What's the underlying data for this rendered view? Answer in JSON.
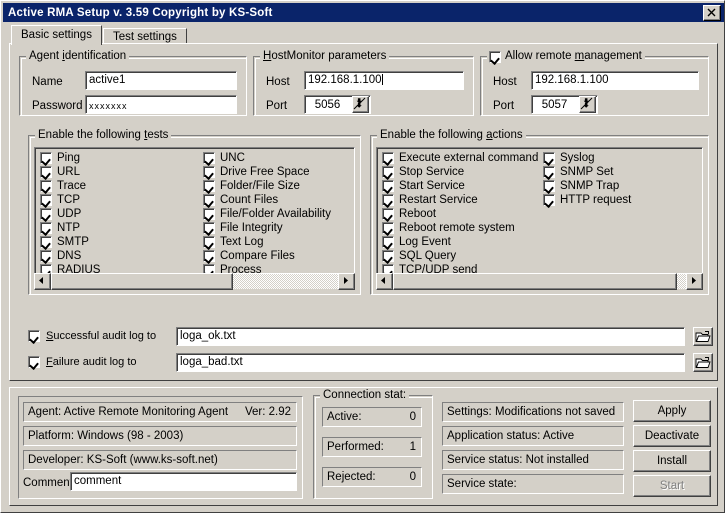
{
  "window": {
    "title": "Active RMA Setup   v. 3.59   Copyright by KS-Soft",
    "close_label": "close-icon"
  },
  "tabs": [
    {
      "label": "Basic settings",
      "active": true
    },
    {
      "label": "Test settings",
      "active": false
    }
  ],
  "agent_identification": {
    "legend": "Agent identification",
    "name_label": "Name",
    "name_value": "active1",
    "password_label": "Password",
    "password_value": "xxxxxxx"
  },
  "hostmonitor_parameters": {
    "legend": "HostMonitor parameters",
    "host_label": "Host",
    "host_value": "192.168.1.100",
    "port_label": "Port",
    "port_value": "5056"
  },
  "remote_management": {
    "legend": "Allow remote management",
    "checked": true,
    "host_label": "Host",
    "host_value": "192.168.1.100",
    "port_label": "Port",
    "port_value": "5057"
  },
  "tests": {
    "legend": "Enable the following tests",
    "column1": [
      {
        "label": "Ping",
        "checked": true
      },
      {
        "label": "URL",
        "checked": true
      },
      {
        "label": "Trace",
        "checked": true
      },
      {
        "label": "TCP",
        "checked": true
      },
      {
        "label": "UDP",
        "checked": true
      },
      {
        "label": "NTP",
        "checked": true
      },
      {
        "label": "SMTP",
        "checked": true
      },
      {
        "label": "DNS",
        "checked": true
      },
      {
        "label": "RADIUS",
        "checked": true
      }
    ],
    "column2": [
      {
        "label": "UNC",
        "checked": true
      },
      {
        "label": "Drive Free Space",
        "checked": true
      },
      {
        "label": "Folder/File Size",
        "checked": true
      },
      {
        "label": "Count Files",
        "checked": true
      },
      {
        "label": "File/Folder Availability",
        "checked": true
      },
      {
        "label": "File Integrity",
        "checked": true
      },
      {
        "label": "Text Log",
        "checked": true
      },
      {
        "label": "Compare Files",
        "checked": true
      },
      {
        "label": "Process",
        "checked": true
      }
    ]
  },
  "actions": {
    "legend": "Enable the following actions",
    "column1": [
      {
        "label": "Execute external command",
        "checked": true
      },
      {
        "label": "Stop Service",
        "checked": true
      },
      {
        "label": "Start Service",
        "checked": true
      },
      {
        "label": "Restart Service",
        "checked": true
      },
      {
        "label": "Reboot",
        "checked": true
      },
      {
        "label": "Reboot remote system",
        "checked": true
      },
      {
        "label": "Log Event",
        "checked": true
      },
      {
        "label": "SQL Query",
        "checked": true
      },
      {
        "label": "TCP/UDP send",
        "checked": true
      }
    ],
    "column2": [
      {
        "label": "Syslog",
        "checked": true
      },
      {
        "label": "SNMP Set",
        "checked": true
      },
      {
        "label": "SNMP Trap",
        "checked": true
      },
      {
        "label": "HTTP request",
        "checked": true
      }
    ]
  },
  "audit_logs": [
    {
      "label": "Successful audit log to",
      "accel": "S",
      "checked": true,
      "value": "loga_ok.txt",
      "browse": "folder-open-icon"
    },
    {
      "label": "Failure audit log to",
      "accel": "F",
      "checked": true,
      "value": "loga_bad.txt",
      "browse": "folder-open-icon"
    }
  ],
  "agent_info": {
    "agent": "Agent: Active Remote Monitoring Agent",
    "version": "Ver: 2.92",
    "platform": "Platform: Windows (98 - 2003)",
    "developer": "Developer: KS-Soft (www.ks-soft.net)",
    "comment_label": "Comment",
    "comment_value": "comment"
  },
  "connection_stat": {
    "legend": "Connection stat:",
    "rows": [
      {
        "label": "Active:",
        "value": "0"
      },
      {
        "label": "Performed:",
        "value": "1"
      },
      {
        "label": "Rejected:",
        "value": "0"
      }
    ]
  },
  "status": {
    "settings": "Settings: Modifications not saved",
    "application": "Application status: Active",
    "service_status": "Service status: Not installed",
    "service_state": "Service state:"
  },
  "buttons": [
    {
      "label": "Apply",
      "enabled": true
    },
    {
      "label": "Deactivate",
      "enabled": true
    },
    {
      "label": "Install",
      "enabled": true
    },
    {
      "label": "Start",
      "enabled": false
    }
  ],
  "colors": {
    "titlebar": "#0a246a",
    "face": "#d4d0c8",
    "field": "#ffffff",
    "disabled_text": "#808080"
  }
}
